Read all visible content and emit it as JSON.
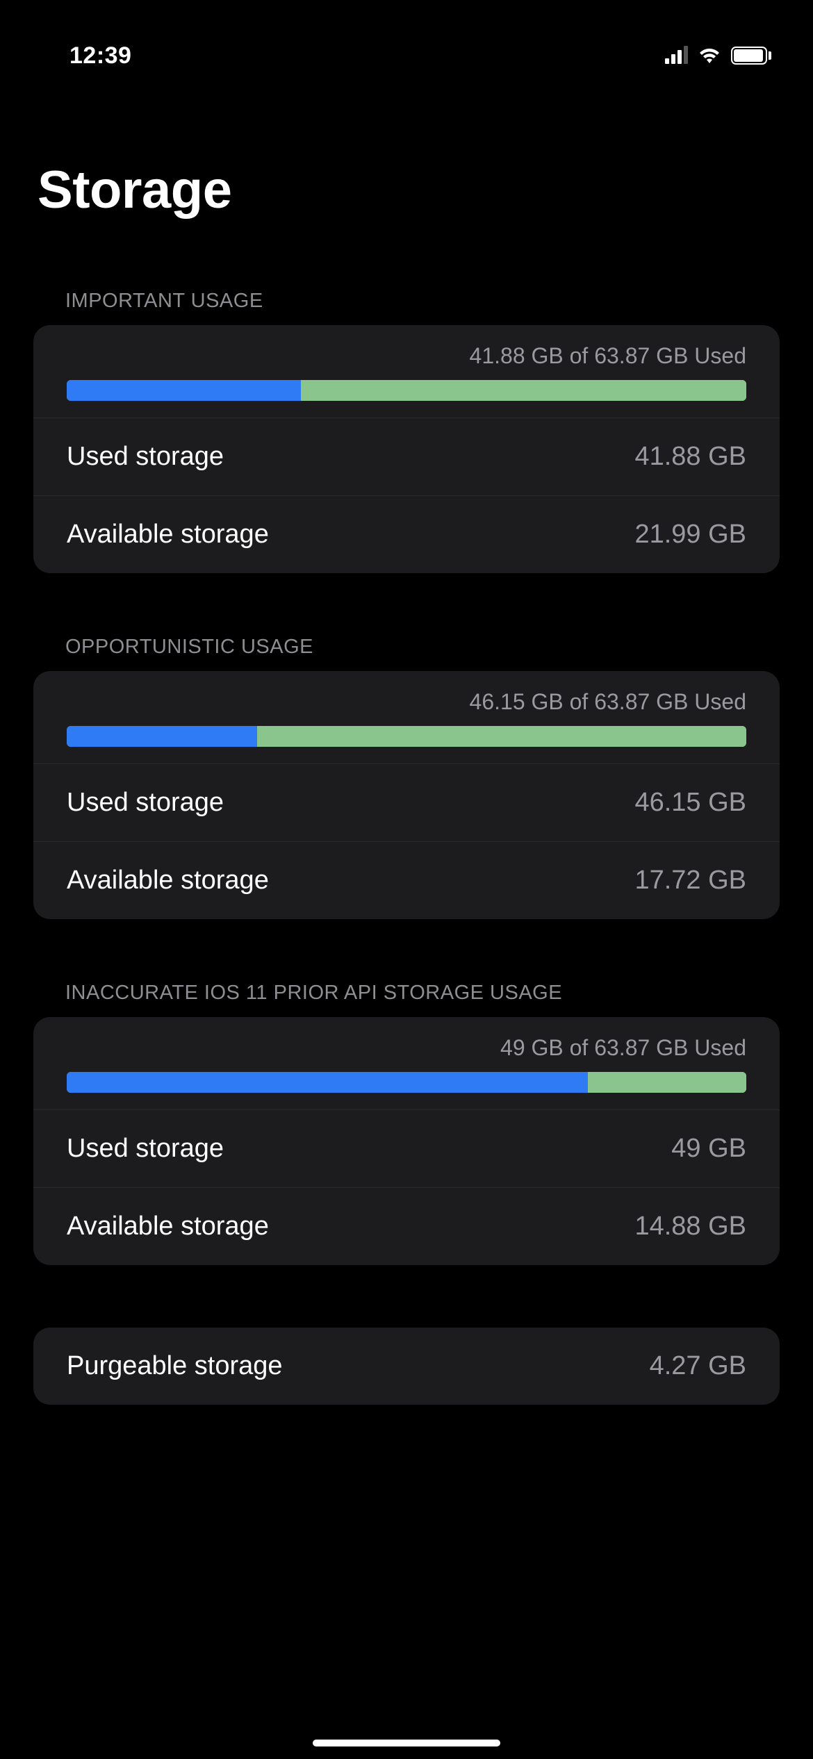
{
  "status": {
    "time": "12:39"
  },
  "title": "Storage",
  "sections": [
    {
      "header": "IMPORTANT USAGE",
      "summary": "41.88 GB of 63.87 GB Used",
      "used_pct": 34.5,
      "rows": [
        {
          "label": "Used storage",
          "value": "41.88 GB"
        },
        {
          "label": "Available storage",
          "value": "21.99 GB"
        }
      ]
    },
    {
      "header": "OPPORTUNISTIC USAGE",
      "summary": "46.15 GB of 63.87 GB Used",
      "used_pct": 28,
      "rows": [
        {
          "label": "Used storage",
          "value": "46.15 GB"
        },
        {
          "label": "Available storage",
          "value": "17.72 GB"
        }
      ]
    },
    {
      "header": "INACCURATE IOS 11 PRIOR API STORAGE USAGE",
      "summary": "49 GB of 63.87 GB Used",
      "used_pct": 76.7,
      "rows": [
        {
          "label": "Used storage",
          "value": "49 GB"
        },
        {
          "label": "Available storage",
          "value": "14.88 GB"
        }
      ]
    }
  ],
  "extra_section": {
    "rows": [
      {
        "label": "Purgeable storage",
        "value": "4.27 GB"
      }
    ]
  }
}
